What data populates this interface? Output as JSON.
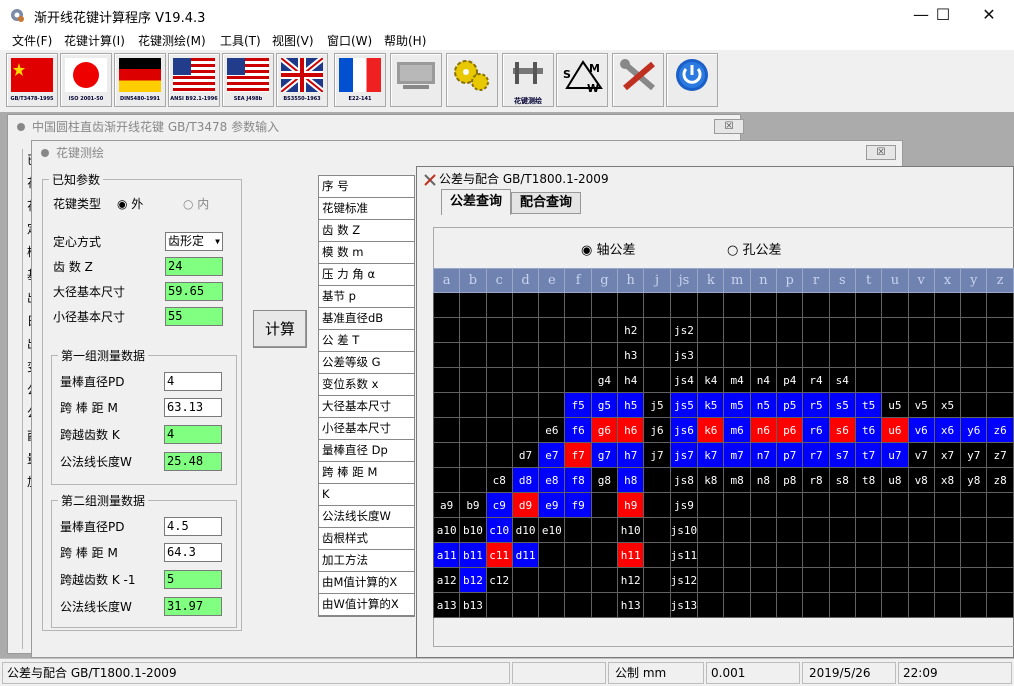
{
  "app": {
    "title": "渐开线花键计算程序    V19.4.3",
    "minimize": "—",
    "maximize": "☐",
    "close": "✕"
  },
  "menu": [
    "文件(F)",
    "花键计算(I)",
    "花键测绘(M)",
    "工具(T)",
    "视图(V)",
    "窗口(W)",
    "帮助(H)"
  ],
  "toolbar": {
    "captions": [
      "GB/T3478-1995",
      "ISO 2001-50",
      "DIN5480-1991",
      "ANSI B92.1-1996",
      "SEA J498b",
      "BS3550-1963",
      "E22-141",
      "",
      "",
      "花键测绘",
      "",
      "",
      ""
    ]
  },
  "win_gb": {
    "title": "中国圆柱直齿渐开线花键 GB/T3478 参数输入",
    "close": "☒"
  },
  "win_measure": {
    "title": "花键测绘",
    "close": "☒",
    "known": {
      "legend": "已知参数",
      "type_label": "花键类型",
      "opt_outer": "外",
      "opt_inner": "内",
      "centering_label": "定心方式",
      "centering_value": "齿形定",
      "teeth_label": "齿      数 Z",
      "teeth": "24",
      "major_label": "大径基本尺寸",
      "major": "59.65",
      "minor_label": "小径基本尺寸",
      "minor": "55"
    },
    "g1": {
      "legend": "第一组测量数据",
      "pin_label": "量棒直径PD",
      "pin": "4",
      "m_label": "跨  棒  距   M",
      "m": "63.13",
      "k_label": "跨越齿数   K",
      "k": "4",
      "w_label": "公法线长度W",
      "w": "25.48"
    },
    "g2": {
      "legend": "第二组测量数据",
      "pin_label": "量棒直径PD",
      "pin": "4.5",
      "m_label": "跨  棒  距   M",
      "m": "64.3",
      "k_label": "跨越齿数  K -1",
      "k": "5",
      "w_label": "公法线长度W",
      "w": "31.97"
    },
    "calc": "计算",
    "labels": [
      "序    号",
      "花键标准",
      "齿      数 Z",
      "模      数 m",
      "压 力 角 α",
      "基节 p",
      "基准直径dB",
      "公    差   T",
      "公差等级 G",
      "变位系数 x",
      "大径基本尺寸",
      "小径基本尺寸",
      "量棒直径 Dp",
      "跨 棒 距   M",
      "K",
      "公法线长度W",
      "齿根样式",
      "加工方法",
      "由M值计算的X",
      "由W值计算的X"
    ],
    "left_stub": [
      "已",
      "花",
      "花",
      "定",
      "模",
      "基",
      "出",
      "日",
      "出",
      "变",
      "公",
      "公",
      "酉",
      "量",
      "加"
    ]
  },
  "win_tol": {
    "title": "公差与配合 GB/T1800.1-2009",
    "tab1": "公差查询",
    "tab2": "配合查询",
    "radio_shaft": "轴公差",
    "radio_hole": "孔公差",
    "grid_headers": [
      "a",
      "b",
      "c",
      "d",
      "e",
      "f",
      "g",
      "h",
      "j",
      "js",
      "k",
      "m",
      "n",
      "p",
      "r",
      "s",
      "t",
      "u",
      "v",
      "x",
      "y",
      "z"
    ],
    "grid_rows": [
      [
        "",
        "",
        "",
        "",
        "",
        "",
        "",
        "",
        "",
        "",
        "",
        "",
        "",
        "",
        "",
        "",
        "",
        "",
        "",
        "",
        "",
        ""
      ],
      [
        "",
        "",
        "",
        "",
        "",
        "",
        "",
        "h2",
        "",
        "js2",
        "",
        "",
        "",
        "",
        "",
        "",
        "",
        "",
        "",
        "",
        "",
        ""
      ],
      [
        "",
        "",
        "",
        "",
        "",
        "",
        "",
        "h3",
        "",
        "js3",
        "",
        "",
        "",
        "",
        "",
        "",
        "",
        "",
        "",
        "",
        "",
        ""
      ],
      [
        "",
        "",
        "",
        "",
        "",
        "",
        "g4",
        "h4",
        "",
        "js4",
        "k4",
        "m4",
        "n4",
        "p4",
        "r4",
        "s4",
        "",
        "",
        "",
        "",
        "",
        ""
      ],
      [
        "",
        "",
        "",
        "",
        "",
        "f5",
        "g5",
        "h5",
        "j5",
        "js5",
        "k5",
        "m5",
        "n5",
        "p5",
        "r5",
        "s5",
        "t5",
        "u5",
        "v5",
        "x5",
        "",
        ""
      ],
      [
        "",
        "",
        "",
        "",
        "e6",
        "f6",
        "g6",
        "h6",
        "j6",
        "js6",
        "k6",
        "m6",
        "n6",
        "p6",
        "r6",
        "s6",
        "t6",
        "u6",
        "v6",
        "x6",
        "y6",
        "z6"
      ],
      [
        "",
        "",
        "",
        "d7",
        "e7",
        "f7",
        "g7",
        "h7",
        "j7",
        "js7",
        "k7",
        "m7",
        "n7",
        "p7",
        "r7",
        "s7",
        "t7",
        "u7",
        "v7",
        "x7",
        "y7",
        "z7"
      ],
      [
        "",
        "",
        "c8",
        "d8",
        "e8",
        "f8",
        "g8",
        "h8",
        "",
        "js8",
        "k8",
        "m8",
        "n8",
        "p8",
        "r8",
        "s8",
        "t8",
        "u8",
        "v8",
        "x8",
        "y8",
        "z8"
      ],
      [
        "a9",
        "b9",
        "c9",
        "d9",
        "e9",
        "f9",
        "",
        "h9",
        "",
        "js9",
        "",
        "",
        "",
        "",
        "",
        "",
        "",
        "",
        "",
        "",
        "",
        ""
      ],
      [
        "a10",
        "b10",
        "c10",
        "d10",
        "e10",
        "",
        "",
        "h10",
        "",
        "js10",
        "",
        "",
        "",
        "",
        "",
        "",
        "",
        "",
        "",
        "",
        "",
        ""
      ],
      [
        "a11",
        "b11",
        "c11",
        "d11",
        "",
        "",
        "",
        "h11",
        "",
        "js11",
        "",
        "",
        "",
        "",
        "",
        "",
        "",
        "",
        "",
        "",
        "",
        ""
      ],
      [
        "a12",
        "b12",
        "c12",
        "",
        "",
        "",
        "",
        "h12",
        "",
        "js12",
        "",
        "",
        "",
        "",
        "",
        "",
        "",
        "",
        "",
        "",
        "",
        ""
      ],
      [
        "a13",
        "b13",
        "",
        "",
        "",
        "",
        "",
        "h13",
        "",
        "js13",
        "",
        "",
        "",
        "",
        "",
        "",
        "",
        "",
        "",
        "",
        "",
        ""
      ]
    ],
    "blue": [
      "f5",
      "g5",
      "h5",
      "js5",
      "k5",
      "m5",
      "n5",
      "p5",
      "r5",
      "s5",
      "t5",
      "e7",
      "g7",
      "h7",
      "js7",
      "k7",
      "m7",
      "n7",
      "p7",
      "r7",
      "s7",
      "t7",
      "u7",
      "d8",
      "e8",
      "f8",
      "h8",
      "c9",
      "e9",
      "f9",
      "c10",
      "a11",
      "b11",
      "d11",
      "b12",
      "f6",
      "h5",
      "js6",
      "m6",
      "r6",
      "t6",
      "v6",
      "x6",
      "y6",
      "z6"
    ],
    "red": [
      "g6",
      "h6",
      "k6",
      "n6",
      "p6",
      "s6",
      "u6",
      "f7",
      "d9",
      "h9",
      "c11",
      "h11"
    ]
  },
  "status": {
    "left": "公差与配合 GB/T1800.1-2009",
    "unit": "公制 mm",
    "value": "0.001",
    "date": "2019/5/26",
    "time": "22:09"
  }
}
